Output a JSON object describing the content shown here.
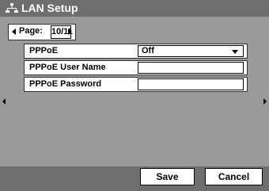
{
  "window": {
    "title": "LAN Setup",
    "icon": "network-icon"
  },
  "pager": {
    "label": "Page:",
    "value": "10/11"
  },
  "fields": [
    {
      "label": "PPPoE",
      "value": "Off",
      "type": "dropdown"
    },
    {
      "label": "PPPoE User Name",
      "value": "",
      "type": "text"
    },
    {
      "label": "PPPoE Password",
      "value": "",
      "type": "password"
    }
  ],
  "buttons": {
    "save": "Save",
    "cancel": "Cancel"
  },
  "colors": {
    "background": "#9a9a9a",
    "titlebar": "#6e6e6e"
  }
}
